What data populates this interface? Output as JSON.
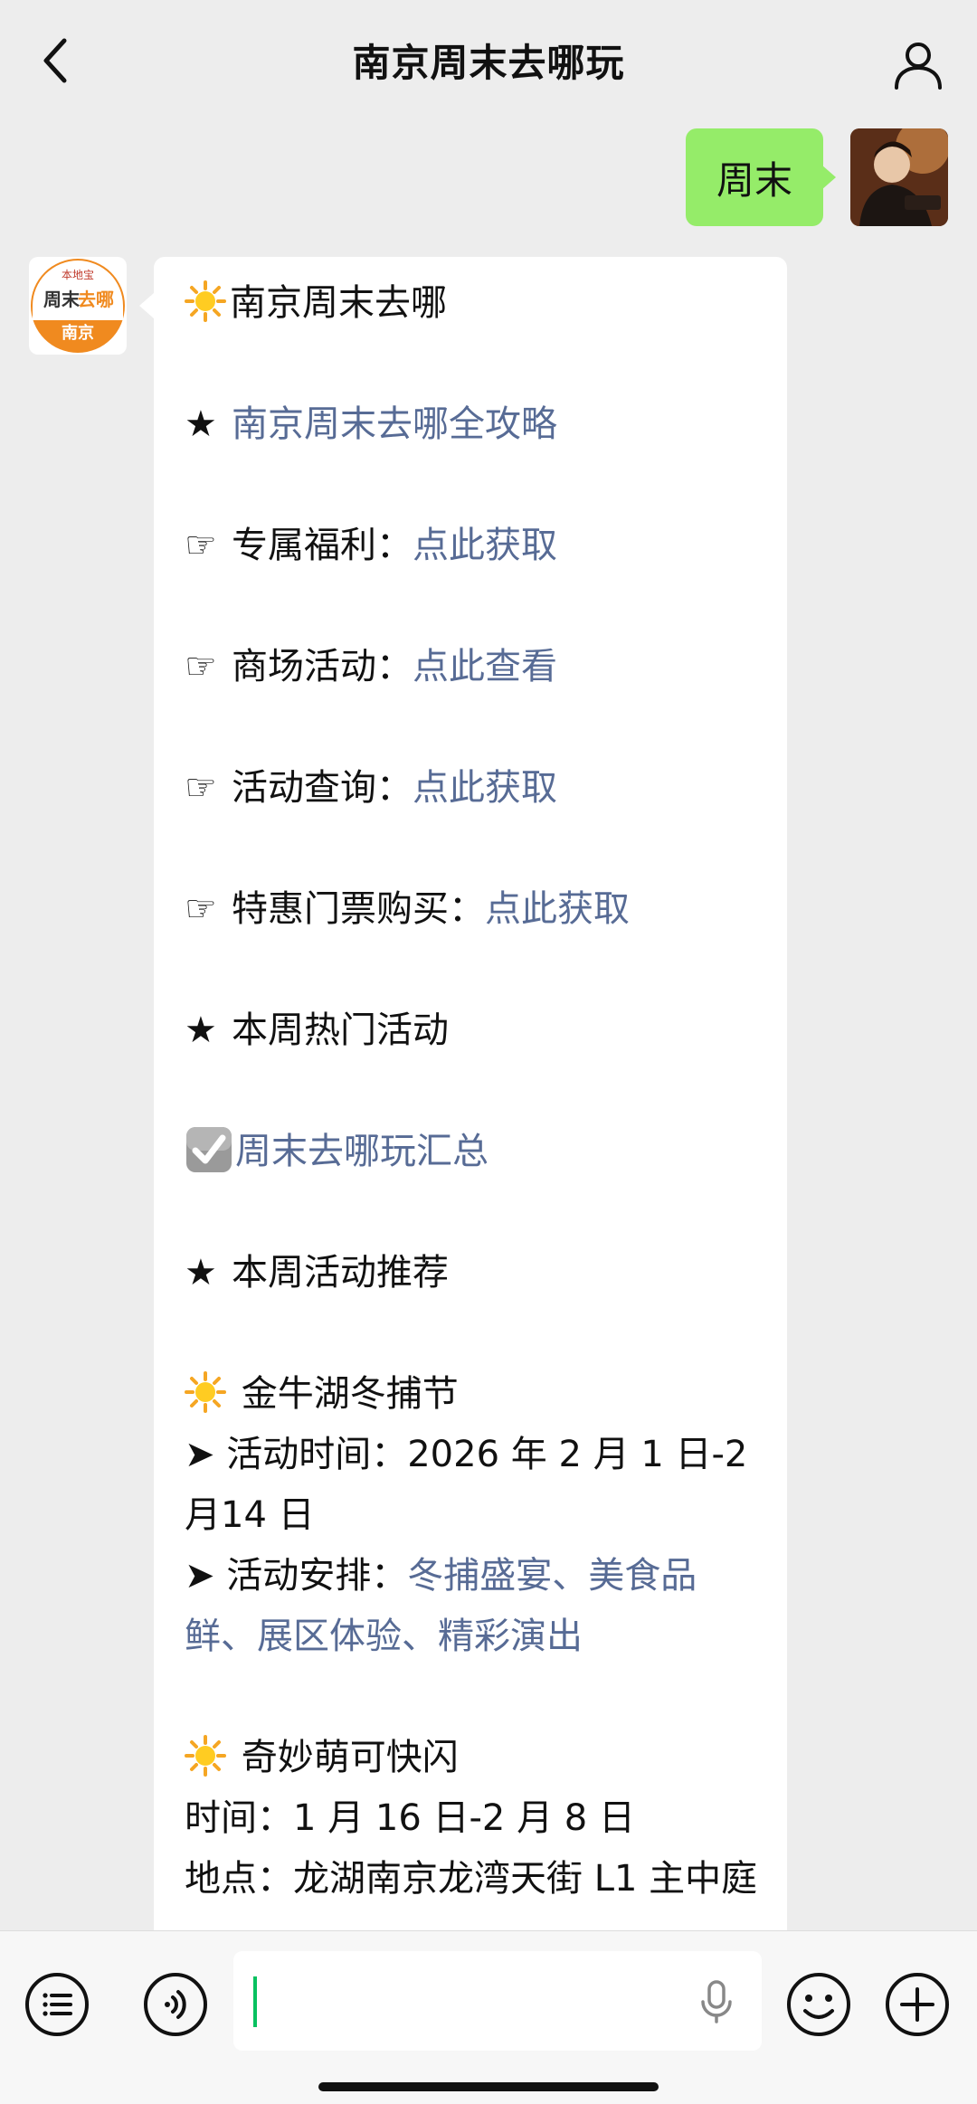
{
  "header": {
    "title": "南京周末去哪玩"
  },
  "sent_message": {
    "text": "周末"
  },
  "bot_avatar": {
    "top_text": "本地宝",
    "main_text_a": "周末",
    "main_text_b": "去哪",
    "bottom_text": "南京"
  },
  "received_message": {
    "line1": "南京周末去哪",
    "line2_symbol": "★",
    "line2_link": "南京周末去哪全攻略",
    "row3_symbol": "☞",
    "row3_label": "专属福利：",
    "row3_link": "点此获取",
    "row4_symbol": "☞",
    "row4_label": "商场活动：",
    "row4_link": "点此查看",
    "row5_symbol": "☞",
    "row5_label": "活动查询：",
    "row5_link": "点此获取",
    "row6_symbol": "☞",
    "row6_label": "特惠门票购买：",
    "row6_link": "点此获取",
    "hot_symbol": "★",
    "hot_title": "本周热门活动",
    "summary_link": "周末去哪玩汇总",
    "rec_symbol": "★",
    "rec_title": "本周活动推荐",
    "event1_title": "金牛湖冬捕节",
    "event1_time_label": "➤ 活动时间：",
    "event1_time_value": "2026 年 2 月 1 日-2 月14 日",
    "event1_plan_label": "➤ 活动安排：",
    "event1_plan_value": "冬捕盛宴、美食品鲜、展区体验、精彩演出",
    "event2_title": "奇妙萌可快闪",
    "event2_time_label": "时间：",
    "event2_time_value": "1 月 16 日-2 月 8 日",
    "event2_place_label": "地点：",
    "event2_place_value": "龙湖南京龙湾天街 L1 主中庭"
  },
  "input_bar": {
    "text": ""
  },
  "colors": {
    "link": "#576b95",
    "sent_bubble": "#95ec69",
    "background": "#ededed",
    "caret": "#07c160"
  }
}
